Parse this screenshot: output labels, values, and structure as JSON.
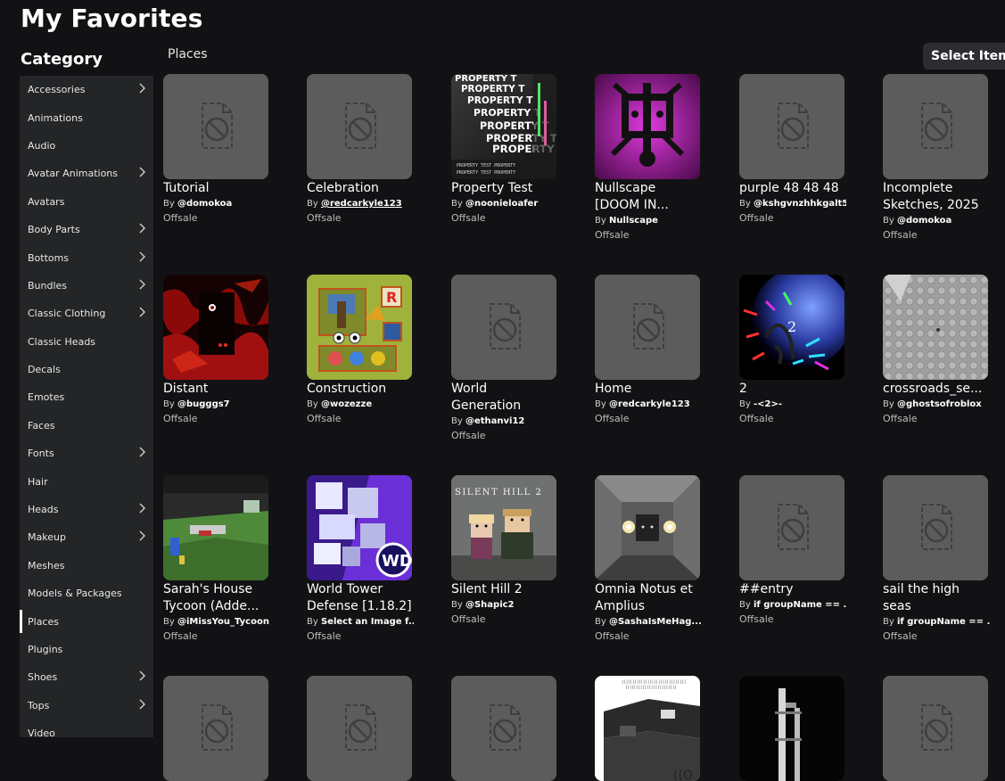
{
  "page": {
    "title": "My Favorites"
  },
  "sidebar": {
    "heading": "Category",
    "items": [
      {
        "label": "Accessories",
        "chevron": true
      },
      {
        "label": "Animations",
        "chevron": false
      },
      {
        "label": "Audio",
        "chevron": false
      },
      {
        "label": "Avatar Animations",
        "chevron": true
      },
      {
        "label": "Avatars",
        "chevron": false
      },
      {
        "label": "Body Parts",
        "chevron": true
      },
      {
        "label": "Bottoms",
        "chevron": true
      },
      {
        "label": "Bundles",
        "chevron": true
      },
      {
        "label": "Classic Clothing",
        "chevron": true
      },
      {
        "label": "Classic Heads",
        "chevron": false
      },
      {
        "label": "Decals",
        "chevron": false
      },
      {
        "label": "Emotes",
        "chevron": false
      },
      {
        "label": "Faces",
        "chevron": false
      },
      {
        "label": "Fonts",
        "chevron": true
      },
      {
        "label": "Hair",
        "chevron": false
      },
      {
        "label": "Heads",
        "chevron": true
      },
      {
        "label": "Makeup",
        "chevron": true
      },
      {
        "label": "Meshes",
        "chevron": false
      },
      {
        "label": "Models & Packages",
        "chevron": false
      },
      {
        "label": "Places",
        "chevron": false,
        "active": true
      },
      {
        "label": "Plugins",
        "chevron": false
      },
      {
        "label": "Shoes",
        "chevron": true
      },
      {
        "label": "Tops",
        "chevron": true
      },
      {
        "label": "Video",
        "chevron": false
      }
    ]
  },
  "main": {
    "section_title": "Places",
    "select_label": "Select Items",
    "by_prefix": "By",
    "items": [
      {
        "name": "Tutorial",
        "creator": "@domokoa",
        "status": "Offsale",
        "thumb": "placeholder"
      },
      {
        "name": "Celebration",
        "creator": "@redcarkyle123",
        "status": "Offsale",
        "thumb": "placeholder",
        "underline": true
      },
      {
        "name": "Property Test",
        "creator": "@noonieloafer",
        "status": "Offsale",
        "thumb": "property"
      },
      {
        "name": "Nullscape [DOOM IN...",
        "creator": "Nullscape",
        "status": "Offsale",
        "thumb": "nullscape"
      },
      {
        "name": "purple 48 48 48",
        "creator": "@kshgvnzhhkgalt5",
        "status": "Offsale",
        "thumb": "placeholder"
      },
      {
        "name": "Incomplete Sketches, 2025",
        "creator": "@domokoa",
        "status": "Offsale",
        "thumb": "placeholder"
      },
      {
        "name": "Distant",
        "creator": "@bugggs7",
        "status": "Offsale",
        "thumb": "distant"
      },
      {
        "name": "Construction",
        "creator": "@wozezze",
        "status": "Offsale",
        "thumb": "construction"
      },
      {
        "name": "World Generation",
        "creator": "@ethanvi12",
        "status": "Offsale",
        "thumb": "placeholder"
      },
      {
        "name": "Home",
        "creator": "@redcarkyle123",
        "status": "Offsale",
        "thumb": "placeholder"
      },
      {
        "name": "2",
        "creator": "-<2>-",
        "status": "Offsale",
        "thumb": "blue2"
      },
      {
        "name": "crossroads_se...",
        "creator": "@ghostsofroblox",
        "status": "Offsale",
        "thumb": "crossroads"
      },
      {
        "name": "Sarah's House Tycoon (Adde...",
        "creator": "@iMissYou_Tycoon",
        "status": "Offsale",
        "thumb": "sarah"
      },
      {
        "name": "World Tower Defense [1.18.2]",
        "creator": "Select an Image f...",
        "status": "Offsale",
        "thumb": "wtd"
      },
      {
        "name": "Silent Hill 2",
        "creator": "@Shapic2",
        "status": "Offsale",
        "thumb": "silenthill",
        "thumb_text": "SILENT HILL 2"
      },
      {
        "name": "Omnia Notus et Amplius",
        "creator": "@SashaIsMeHag...",
        "status": "Offsale",
        "thumb": "omnia"
      },
      {
        "name": "##entry",
        "creator": "if groupName == ...",
        "status": "Offsale",
        "thumb": "placeholder"
      },
      {
        "name": "sail the high seas",
        "creator": "if groupName == ...",
        "status": "Offsale",
        "thumb": "placeholder"
      },
      {
        "name": "",
        "creator": "",
        "status": "",
        "thumb": "placeholder"
      },
      {
        "name": "",
        "creator": "",
        "status": "",
        "thumb": "placeholder"
      },
      {
        "name": "",
        "creator": "",
        "status": "",
        "thumb": "placeholder"
      },
      {
        "name": "",
        "creator": "",
        "status": "",
        "thumb": "room"
      },
      {
        "name": "",
        "creator": "",
        "status": "",
        "thumb": "dark"
      },
      {
        "name": "",
        "creator": "",
        "status": "",
        "thumb": "placeholder"
      }
    ]
  }
}
